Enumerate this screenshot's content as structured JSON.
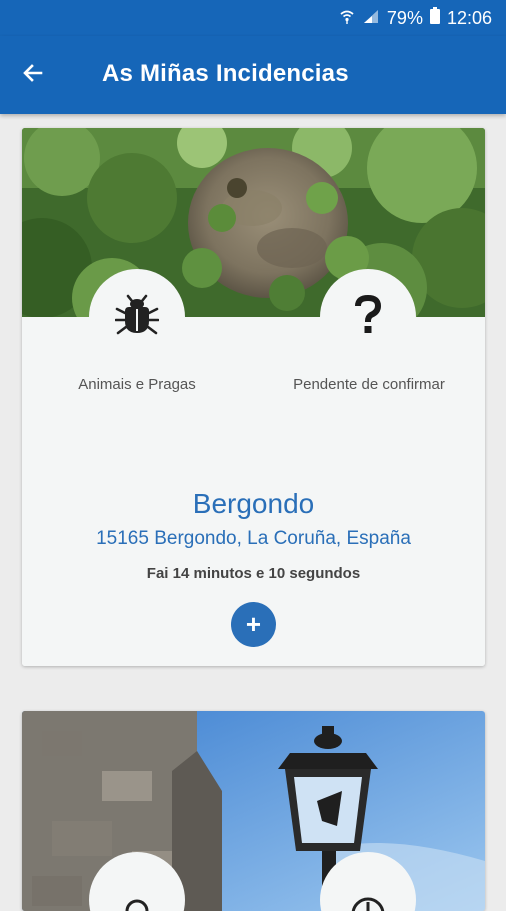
{
  "status_bar": {
    "battery": "79%",
    "time": "12:06"
  },
  "app_bar": {
    "title": "As Miñas Incidencias",
    "back_icon": "arrow-left-icon"
  },
  "incidents": [
    {
      "category": "Animais e Pragas",
      "category_icon": "bug-icon",
      "status": "Pendente de confirmar",
      "status_icon": "question-icon",
      "city": "Bergondo",
      "address": "15165 Bergondo, La Coruña, España",
      "elapsed": "Fai 14 minutos e 10 segundos",
      "action_label": "+"
    }
  ],
  "colors": {
    "primary": "#1666b8",
    "accent": "#2a6fb8",
    "card_bg": "#f4f6f6"
  }
}
